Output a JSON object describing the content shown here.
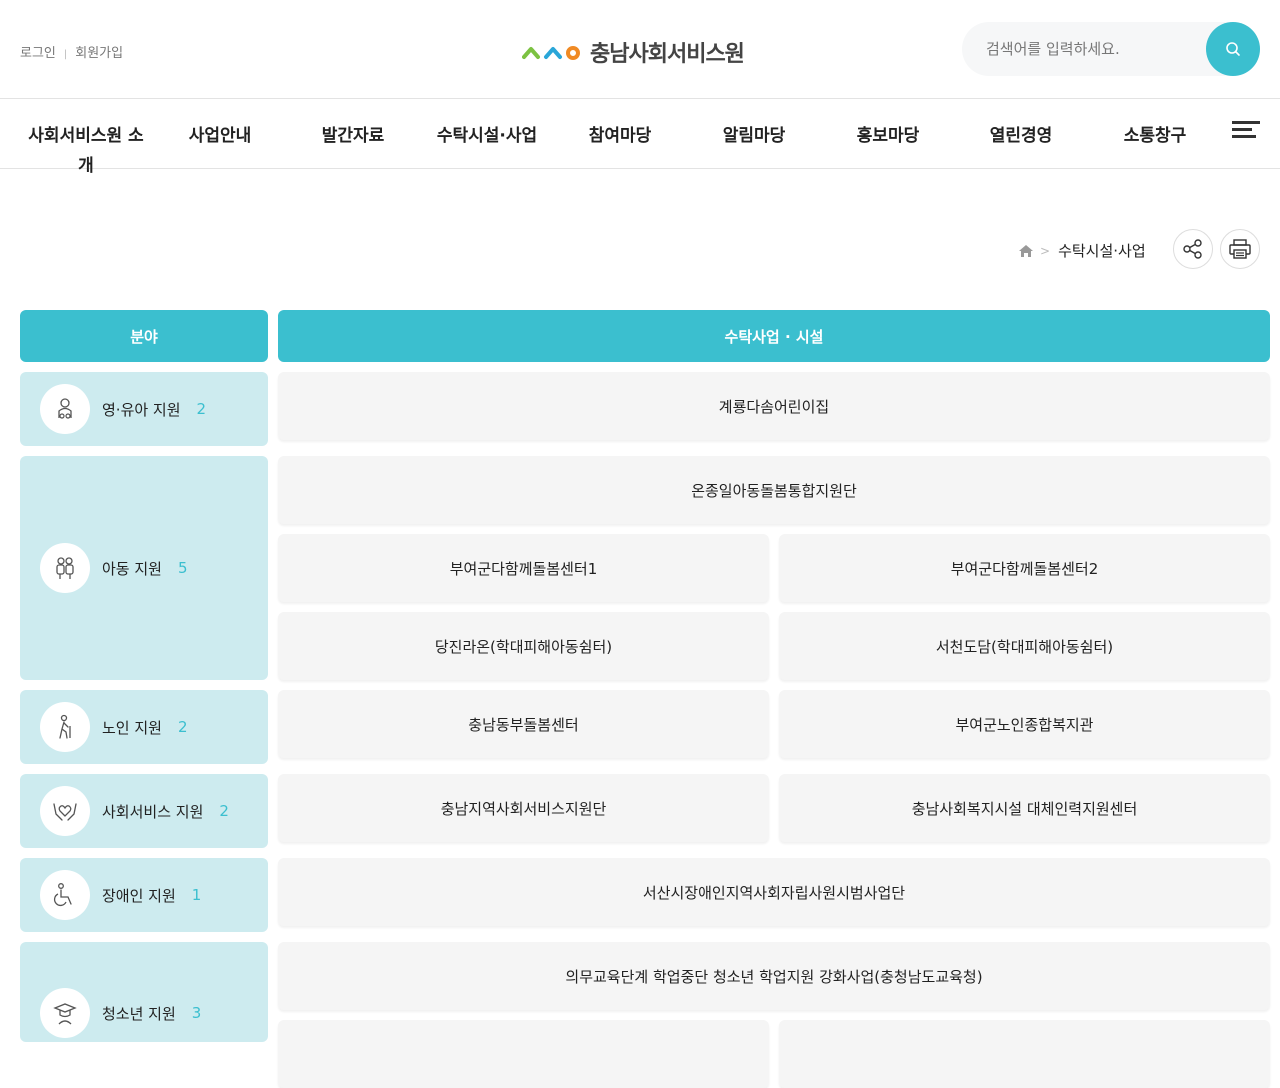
{
  "header": {
    "login": "로그인",
    "join": "회원가입",
    "logo_text": "충남사회서비스원",
    "search_placeholder": "검색어를 입력하세요."
  },
  "nav": [
    {
      "label": "사회서비스원 소개"
    },
    {
      "label": "사업안내"
    },
    {
      "label": "발간자료"
    },
    {
      "label": "수탁시설·사업"
    },
    {
      "label": "참여마당"
    },
    {
      "label": "알림마당"
    },
    {
      "label": "홍보마당"
    },
    {
      "label": "열린경영"
    },
    {
      "label": "소통창구"
    }
  ],
  "location": {
    "current": "수탁시설·사업"
  },
  "table": {
    "head_category": "분야",
    "head_facility": "수탁사업 · 시설",
    "categories": [
      {
        "name": "영·유아 지원",
        "count": "2",
        "icon": "baby-icon"
      },
      {
        "name": "아동 지원",
        "count": "5",
        "icon": "children-icon"
      },
      {
        "name": "노인 지원",
        "count": "2",
        "icon": "elderly-icon"
      },
      {
        "name": "사회서비스 지원",
        "count": "2",
        "icon": "caring-hands-icon"
      },
      {
        "name": "장애인 지원",
        "count": "1",
        "icon": "wheelchair-icon"
      },
      {
        "name": "청소년 지원",
        "count": "3",
        "icon": "graduate-icon"
      }
    ],
    "facilities": [
      "계룡다솜어린이집",
      "온종일아동돌봄통합지원단",
      "부여군다함께돌봄센터1",
      "부여군다함께돌봄센터2",
      "당진라온(학대피해아동쉼터)",
      "서천도담(학대피해아동쉼터)",
      "충남동부돌봄센터",
      "부여군노인종합복지관",
      "충남지역사회서비스지원단",
      "충남사회복지시설 대체인력지원센터",
      "서산시장애인지역사회자립사원시범사업단",
      "의무교육단계 학업중단 청소년 학업지원 강화사업(충청남도교육청)"
    ]
  }
}
